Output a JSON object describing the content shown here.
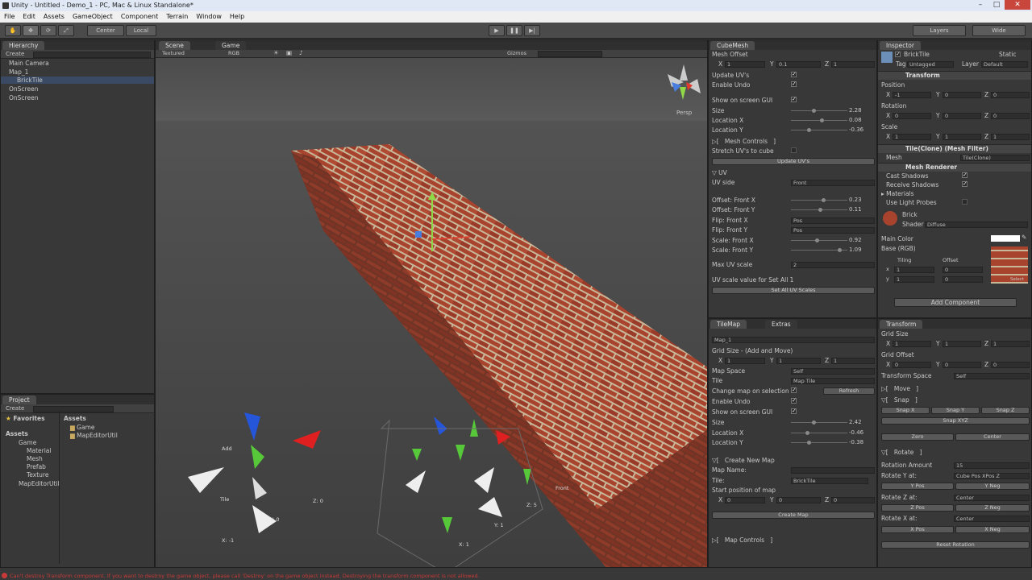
{
  "window": {
    "title": "Unity - Untitled - Demo_1 - PC, Mac & Linux Standalone*",
    "min": "–",
    "max": "□",
    "close": "✕"
  },
  "menu": [
    "File",
    "Edit",
    "Assets",
    "GameObject",
    "Component",
    "Terrain",
    "Window",
    "Help"
  ],
  "toolbar": {
    "center": "Center",
    "local": "Local",
    "layers": "Layers",
    "layout": "Wide"
  },
  "hierarchy": {
    "tab": "Hierarchy",
    "create": "Create",
    "items": [
      "Main Camera",
      "Map_1",
      "BrickTile",
      "OnScreen",
      "OnScreen"
    ]
  },
  "project": {
    "tab": "Project",
    "create": "Create",
    "favorites": "Favorites",
    "assets": "Assets",
    "tree": [
      "Assets",
      "Game",
      "Material",
      "Mesh",
      "Prefab",
      "Texture",
      "MapEditorUtil"
    ],
    "files": [
      "Game",
      "MapEditorUtil"
    ]
  },
  "scene": {
    "tab_scene": "Scene",
    "tab_game": "Game",
    "textured": "Textured",
    "rgb": "RGB",
    "gizmos": "Gizmos",
    "persp": "Persp",
    "labels": {
      "add": "Add",
      "tile": "Tile",
      "y0": "Y: 0",
      "z0": "Z: 0",
      "xm1": "X: -1",
      "z5": "Z: 5",
      "y1": "Y: 1",
      "x1": "X: 1",
      "front": "Front"
    }
  },
  "cubemesh": {
    "tab": "CubeMesh",
    "mesh_offset": "Mesh Offset",
    "x": "X",
    "x_val": "1",
    "y": "Y",
    "y_val": "0.1",
    "z": "Z",
    "z_val": "1",
    "update_uvs": "Update UV's",
    "enable_undo": "Enable Undo",
    "show_gui": "Show on screen GUI",
    "size": "Size",
    "size_val": "2.28",
    "loc_x": "Location X",
    "loc_x_val": "0.08",
    "loc_y": "Location Y",
    "loc_y_val": "-0.36",
    "mesh_controls": "Mesh Controls",
    "stretch": "Stretch UV's to cube",
    "update_btn": "Update UV's",
    "uv": "UV",
    "uv_side": "UV side",
    "uv_side_val": "Front",
    "off_x": "Offset: Front X",
    "off_x_val": "0.23",
    "off_y": "Offset: Front Y",
    "off_y_val": "0.11",
    "flip_x": "Flip: Front X",
    "flip_x_val": "Pos",
    "flip_y": "Flip: Front Y",
    "flip_y_val": "Pos",
    "scale_x": "Scale: Front X",
    "scale_x_val": "0.92",
    "scale_y": "Scale: Front Y",
    "scale_y_val": "1.09",
    "max_uv": "Max UV scale",
    "max_uv_val": "2",
    "uv_scale_all": "UV scale value for Set All",
    "uv_scale_all_val": "1",
    "set_all": "Set All UV Scales"
  },
  "tilemap": {
    "tab": "TileMap",
    "tab2": "Extras",
    "map_sel": "Map_1",
    "grid_size": "Grid Size - (Add and Move)",
    "gx": "1",
    "gy": "1",
    "gz": "1",
    "map_space": "Map Space",
    "map_space_val": "Self",
    "tile": "Tile",
    "tile_val": "Map Tile",
    "change_map": "Change map on selection",
    "refresh": "Refresh",
    "enable_undo": "Enable Undo",
    "show_gui": "Show on screen GUI",
    "size": "Size",
    "size_val": "2.42",
    "loc_x": "Location X",
    "loc_x_val": "-0.46",
    "loc_y": "Location Y",
    "loc_y_val": "-0.38",
    "create_new": "Create New Map",
    "map_name": "Map Name:",
    "tile2": "Tile:",
    "tile2_val": "BrickTile",
    "start_pos": "Start position of map",
    "sx": "0",
    "sy": "0",
    "sz": "0",
    "create_btn": "Create Map",
    "map_controls": "Map Controls"
  },
  "inspector": {
    "tab": "Inspector",
    "name": "BrickTile",
    "static": "Static",
    "tag": "Tag",
    "tag_val": "Untagged",
    "layer": "Layer",
    "layer_val": "Default",
    "transform": "Transform",
    "position": "Position",
    "px": "-1",
    "py": "0",
    "pz": "0",
    "rotation": "Rotation",
    "rx": "0",
    "ry": "0",
    "rz": "0",
    "scale": "Scale",
    "sx": "1",
    "sy": "1",
    "sz": "1",
    "mesh_filter": "Tile(Clone) (Mesh Filter)",
    "mesh": "Mesh",
    "mesh_val": "Tile(Clone)",
    "renderer": "Mesh Renderer",
    "cast": "Cast Shadows",
    "receive": "Receive Shadows",
    "materials": "Materials",
    "light_probes": "Use Light Probes",
    "mat_name": "Brick",
    "shader": "Shader",
    "shader_val": "Diffuse",
    "main_color": "Main Color",
    "base": "Base (RGB)",
    "tiling": "Tiling",
    "offset": "Offset",
    "tx": "1",
    "ty": "1",
    "ox": "0",
    "oy": "0",
    "select": "Select",
    "add_comp": "Add Component"
  },
  "transformpanel": {
    "tab": "Transform",
    "grid_size": "Grid Size",
    "gx": "1",
    "gy": "1",
    "gz": "1",
    "grid_offset": "Grid Offset",
    "ox": "0",
    "oy": "0",
    "oz": "0",
    "space": "Transform Space",
    "space_val": "Self",
    "move": "Move",
    "snap": "Snap",
    "snap_x": "Snap X",
    "snap_y": "Snap Y",
    "snap_z": "Snap Z",
    "snap_xyz": "Snap XYZ",
    "zero": "Zero",
    "center": "Center",
    "rotate": "Rotate",
    "rot_amount": "Rotation Amount",
    "rot_amount_val": "15",
    "rot_y": "Rotate Y at:",
    "rot_y_val": "Cube Pos XPos Z",
    "y_pos": "Y Pos",
    "y_neg": "Y Neg",
    "rot_z": "Rotate Z at:",
    "rot_z_val": "Center",
    "z_pos": "Z Pos",
    "z_neg": "Z Neg",
    "rot_x": "Rotate X at:",
    "rot_x_val": "Center",
    "x_pos": "X Pos",
    "x_neg": "X Neg",
    "reset": "Reset Rotation"
  },
  "status": "Can't destroy Transform component. If you want to destroy the game object, please call 'Destroy' on the game object instead. Destroying the transform component is not allowed.",
  "colors": {
    "accent": "#3d6fb6",
    "brick": "#a8432e",
    "mortar": "#c9b79a",
    "error": "#c83a3a"
  }
}
